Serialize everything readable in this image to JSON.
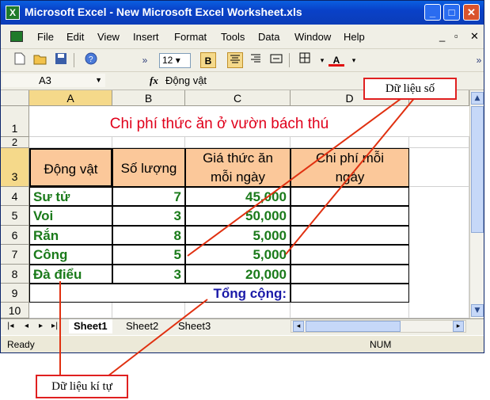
{
  "window": {
    "title": "Microsoft Excel - New Microsoft Excel Worksheet.xls",
    "controls": [
      "_",
      "□",
      "✕"
    ]
  },
  "menu": {
    "items": [
      "File",
      "Edit",
      "View",
      "Insert",
      "Format",
      "Tools",
      "Data",
      "Window",
      "Help"
    ],
    "mdi_controls": [
      "_",
      "▫",
      "✕"
    ]
  },
  "toolbar": {
    "font_size": "12",
    "bold_label": "B",
    "font_color_label": "A"
  },
  "formula_bar": {
    "name_box": "A3",
    "fx_label": "fx",
    "content": "Động vật"
  },
  "sheet": {
    "columns": [
      "A",
      "B",
      "C",
      "D"
    ],
    "rows": [
      "1",
      "2",
      "3",
      "4",
      "5",
      "6",
      "7",
      "8",
      "9",
      "10"
    ],
    "title": "Chi phí thức ăn ở vườn bách thú",
    "headers": [
      "Động vật",
      "Số lượng",
      "Giá thức ăn mỗi ngày",
      "Chi phí mỗi ngày"
    ],
    "data": [
      {
        "animal": "Sư tử",
        "qty": "7",
        "price": "45,000"
      },
      {
        "animal": "Voi",
        "qty": "3",
        "price": "50,000"
      },
      {
        "animal": "Rắn",
        "qty": "8",
        "price": "5,000"
      },
      {
        "animal": "Công",
        "qty": "5",
        "price": "5,000"
      },
      {
        "animal": "Đà điểu",
        "qty": "3",
        "price": "20,000"
      }
    ],
    "total_label": "Tổng cộng:"
  },
  "tabs": [
    "Sheet1",
    "Sheet2",
    "Sheet3"
  ],
  "status": {
    "left": "Ready",
    "num": "NUM"
  },
  "annotations": {
    "numeric_label": "Dữ liệu số",
    "text_label": "Dữ liệu kí tự"
  },
  "colors": {
    "title_red": "#e0001b",
    "header_fill": "#fbc89a",
    "data_green": "#1a7a1a",
    "total_blue": "#1a1aa8",
    "callout_border": "#e02020"
  }
}
